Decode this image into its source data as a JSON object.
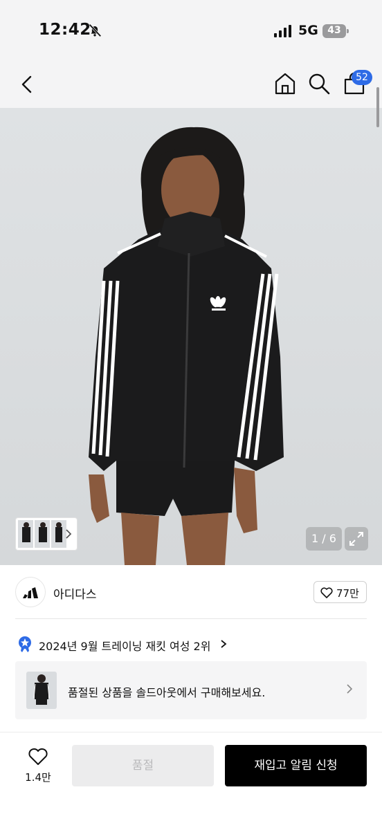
{
  "status_bar": {
    "time": "12:42",
    "network": "5G",
    "battery": "43"
  },
  "header": {
    "cart_count": "52"
  },
  "gallery": {
    "counter": "1 / 6"
  },
  "brand": {
    "name": "아디다스",
    "likes": "77만"
  },
  "ranking": {
    "text": "2024년 9월 트레이닝 재킷 여성 2위"
  },
  "banner": {
    "text": "품절된 상품을 솔드아웃에서 구매해보세요."
  },
  "bottom_bar": {
    "wish_count": "1.4만",
    "soldout_label": "품절",
    "restock_label": "재입고 알림 신청"
  },
  "colors": {
    "accent_blue": "#2e6be6",
    "primary_button": "#000000",
    "disabled_button": "#ececed"
  }
}
